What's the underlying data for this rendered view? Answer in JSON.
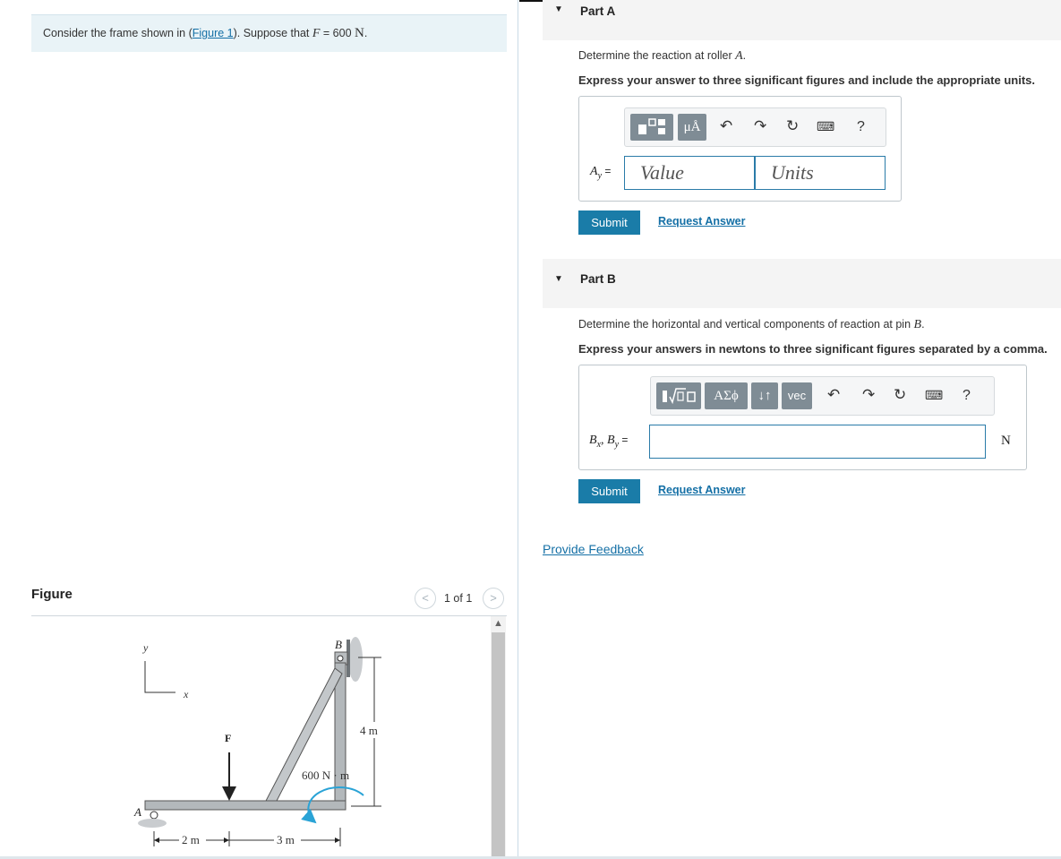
{
  "problem": {
    "text_before": "Consider the frame shown in (",
    "figure_link": "Figure 1",
    "text_after": "). Suppose that ",
    "var": "F",
    "equals": " = 600 ",
    "unit": "N",
    "period": "."
  },
  "figure_panel": {
    "heading": "Figure",
    "pager_label": "1 of 1",
    "prev_icon": "chevron-left-icon",
    "next_icon": "chevron-right-icon"
  },
  "figure": {
    "y_axis": "y",
    "x_axis": "x",
    "label_A": "A",
    "label_B": "B",
    "label_F": "F",
    "moment": "600 N · m",
    "dim_4m": "4 m",
    "dim_2m": "2 m",
    "dim_3m": "3 m"
  },
  "partA": {
    "title": "Part A",
    "question_pre": "Determine the reaction at roller ",
    "question_var": "A",
    "question_post": ".",
    "instruction": "Express your answer to three significant figures and include the appropriate units.",
    "label_main": "A",
    "label_sub": "y",
    "label_eq": " =",
    "value_placeholder": "Value",
    "units_placeholder": "Units",
    "toolbar": {
      "units_button": "μÅ",
      "help": "?"
    },
    "submit": "Submit",
    "request": "Request Answer"
  },
  "partB": {
    "title": "Part B",
    "question_pre": "Determine the horizontal and vertical components of reaction at pin ",
    "question_var": "B",
    "question_post": ".",
    "instruction": "Express your answers in newtons to three significant figures separated by a comma.",
    "label_a": "B",
    "label_a_sub": "x",
    "label_sep": ", ",
    "label_b": "B",
    "label_b_sub": "y",
    "label_eq": " =",
    "unit": "N",
    "toolbar": {
      "greek": "ΑΣϕ",
      "arrows": "↓↑",
      "vec": "vec",
      "help": "?"
    },
    "submit": "Submit",
    "request": "Request Answer"
  },
  "feedback": "Provide Feedback",
  "colors": {
    "accent": "#1a7ca8",
    "link": "#1570a6",
    "problem_bg": "#e9f3f7",
    "moment_arrow": "#2aa3d6"
  }
}
